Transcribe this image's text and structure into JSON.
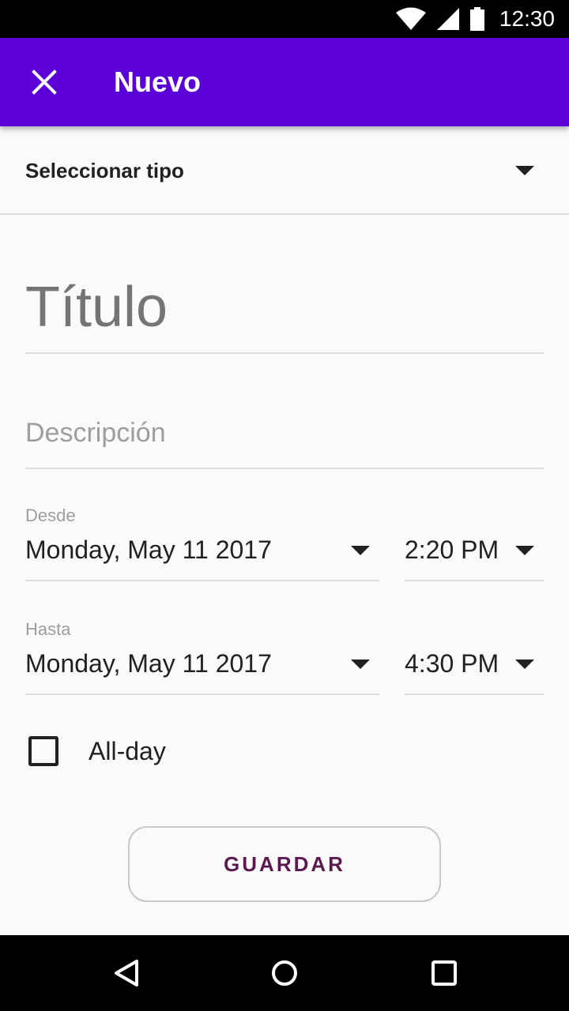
{
  "status_bar": {
    "time": "12:30",
    "icons": [
      "wifi-icon",
      "signal-icon",
      "battery-icon"
    ]
  },
  "app_bar": {
    "title": "Nuevo",
    "close_icon": "close-icon",
    "color": "#5c00d9"
  },
  "type_selector": {
    "label": "Seleccionar tipo",
    "icon": "dropdown-arrow-icon"
  },
  "form": {
    "title_placeholder": "Título",
    "description_placeholder": "Descripción",
    "from": {
      "label": "Desde",
      "date": "Monday, May 11 2017",
      "time": "2:20 PM"
    },
    "to": {
      "label": "Hasta",
      "date": "Monday, May 11 2017",
      "time": "4:30 PM"
    },
    "all_day": {
      "label": "All-day",
      "checked": false
    },
    "save_label": "GUARDAR",
    "save_color": "#5b1a4f"
  },
  "nav_bar": {
    "icons": [
      "back-icon",
      "home-icon",
      "recents-icon"
    ]
  }
}
